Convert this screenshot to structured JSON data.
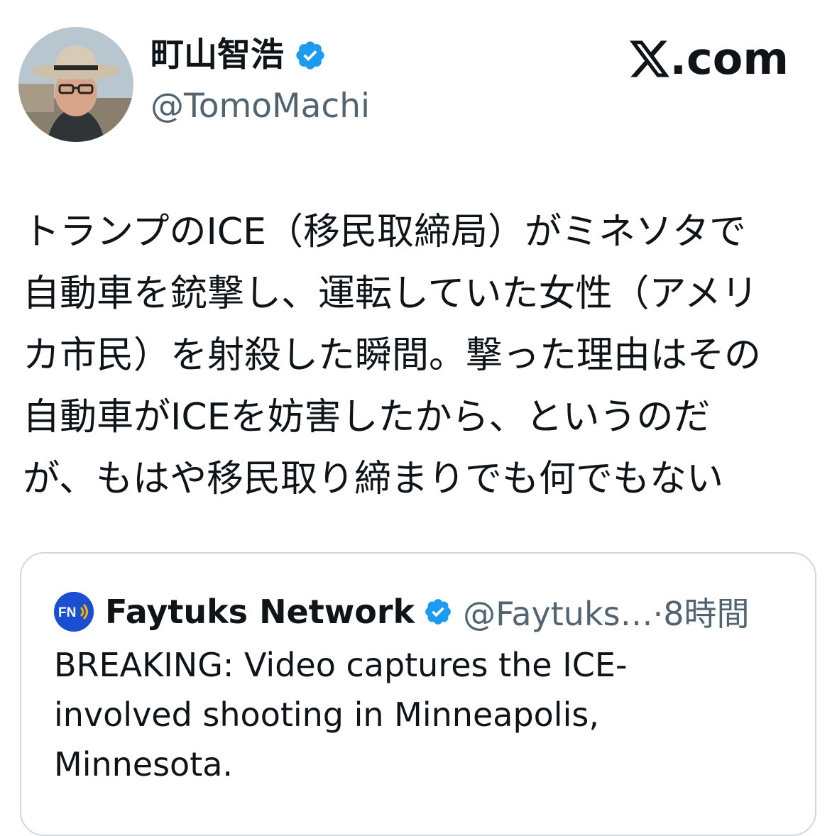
{
  "author": {
    "display_name": "町山智浩",
    "handle": "@TomoMachi",
    "verified": true,
    "avatar_icon": "profile-photo"
  },
  "site": {
    "logo_icon": "x-logo",
    "label": ".com"
  },
  "tweet": {
    "lines": [
      "トランプのICE（移民取締局）がミネソタで",
      "自動車を銃撃し、運転していた女性（アメリ",
      "カ市民）を射殺した瞬間。撃った理由はその",
      "自動車がICEを妨害したから、というのだ",
      "が、もはや移民取り締まりでも何でもない"
    ]
  },
  "quoted_tweet": {
    "logo_icon": "faytuks-logo",
    "logo_text": "FN",
    "display_name": "Faytuks Network",
    "verified": true,
    "handle_time": "@Faytuks…·8時間",
    "lines": [
      "BREAKING: Video captures the ICE-",
      "involved shooting in Minneapolis,",
      "Minnesota."
    ]
  },
  "colors": {
    "text": "#0f1419",
    "secondary": "#536471",
    "verified_badge": "#1d9bf0",
    "border": "#cfd9de"
  }
}
